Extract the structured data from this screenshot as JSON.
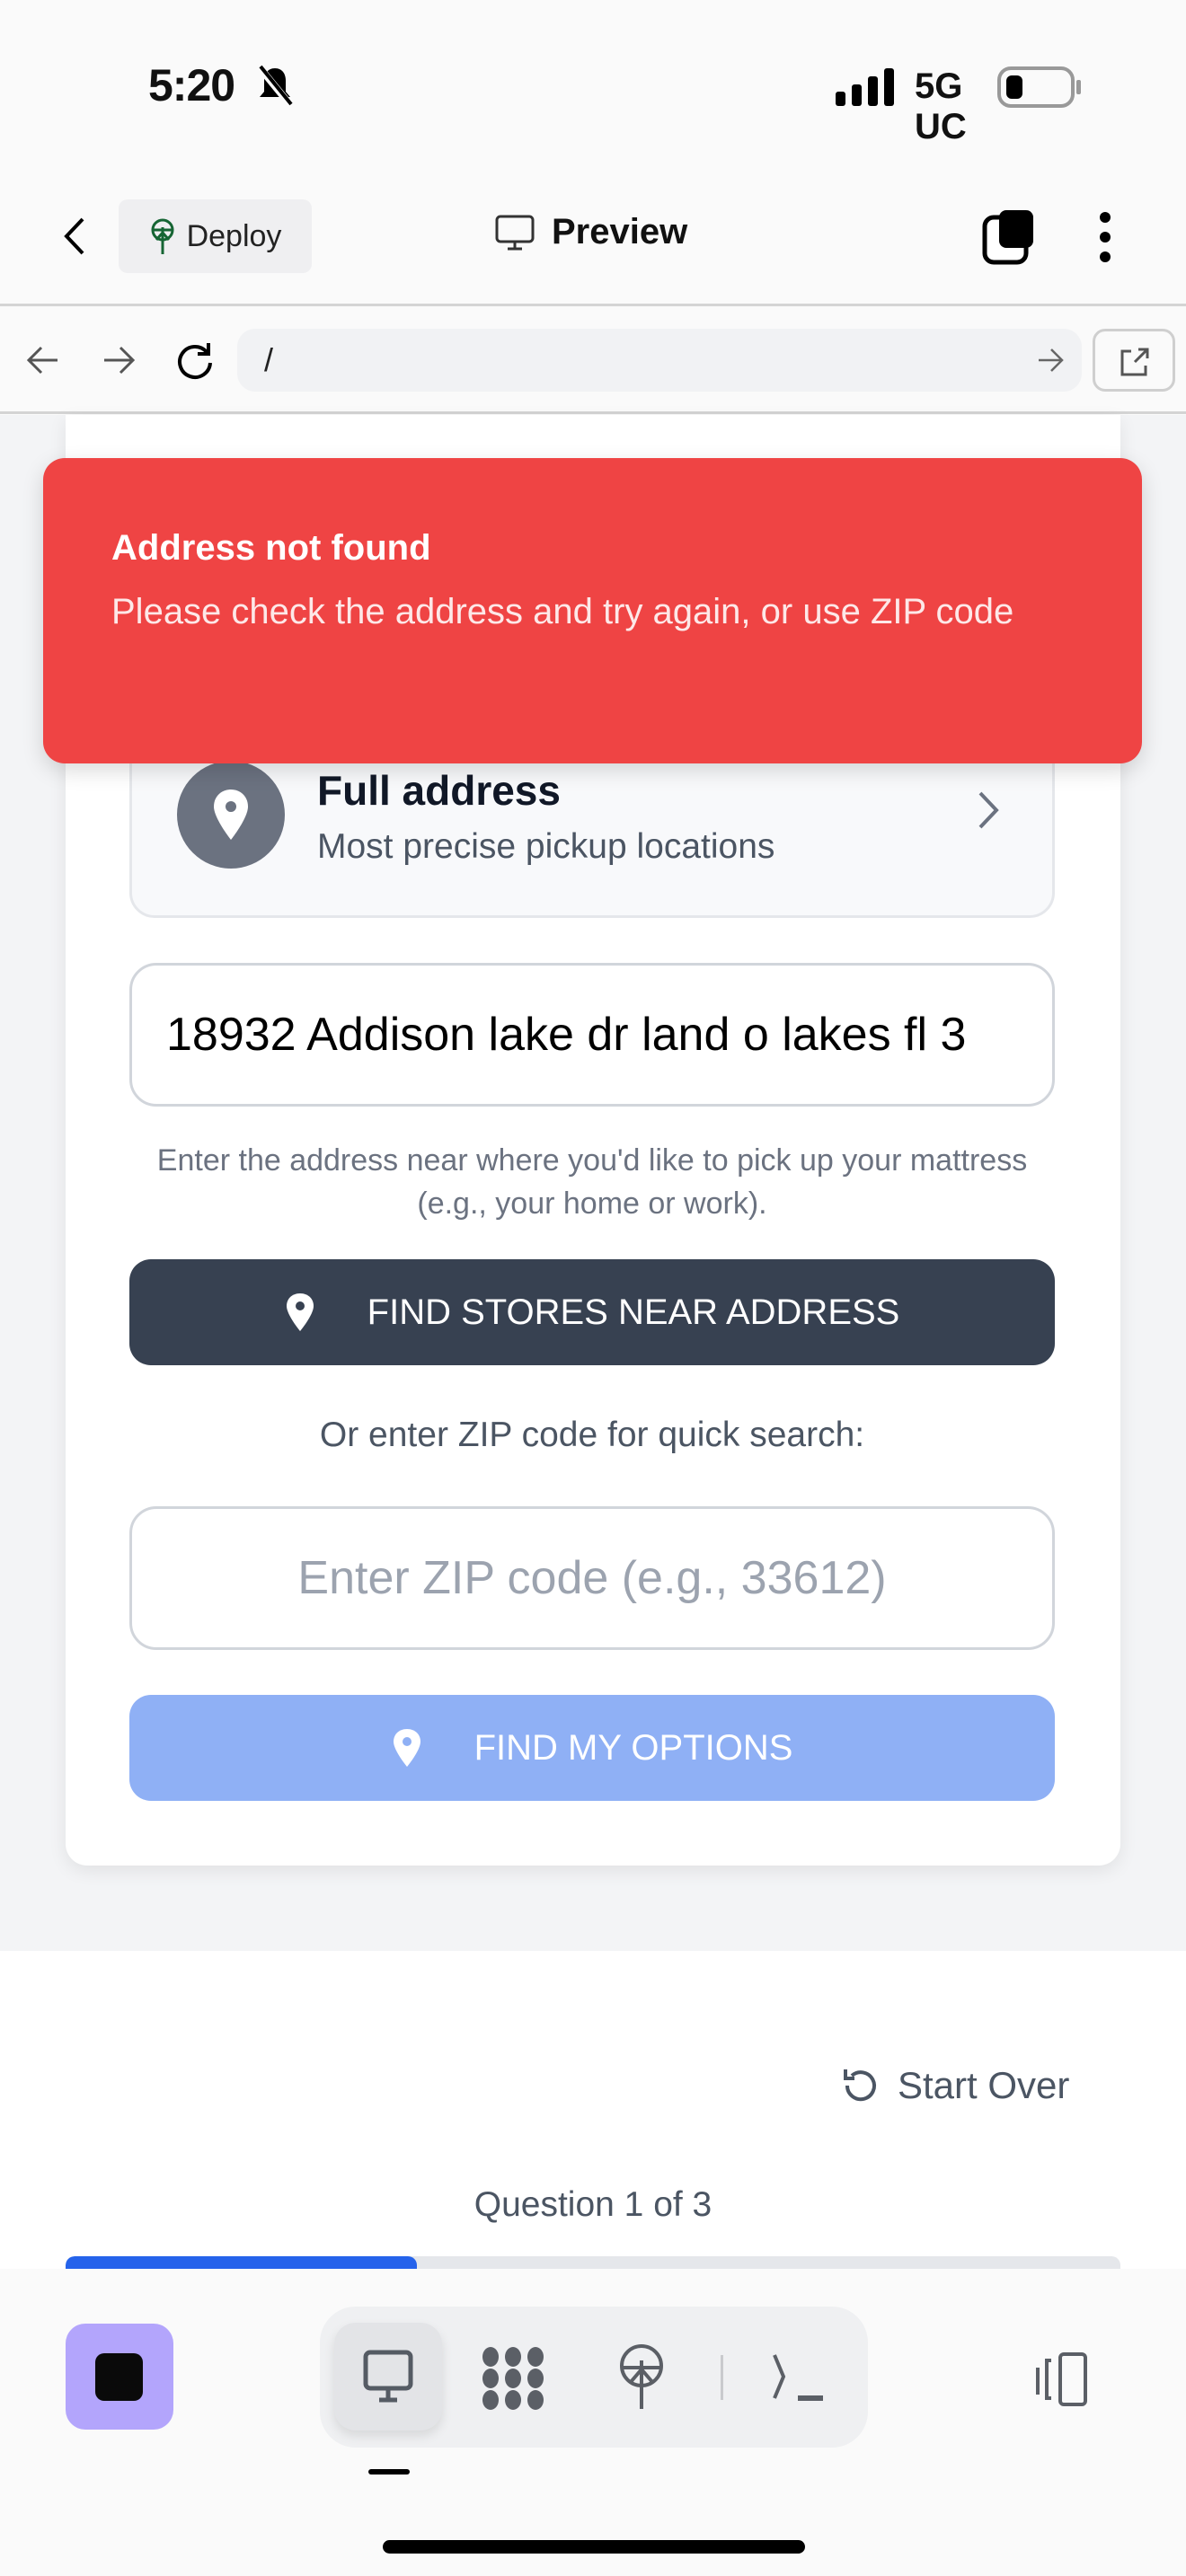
{
  "status_bar": {
    "time": "5:20",
    "network": "5G UC",
    "battery_percent": 20
  },
  "app_bar": {
    "deploy_label": "Deploy",
    "title": "Preview"
  },
  "browser": {
    "url": "/"
  },
  "toast": {
    "title": "Address not found",
    "message": "Please check the address and try again, or use ZIP code",
    "color": "#ef4444"
  },
  "form": {
    "option": {
      "title": "Full address",
      "subtitle": "Most precise pickup locations"
    },
    "address_value": "18932 Addison lake dr land o lakes fl 3",
    "helper": "Enter the address near where you'd like to pick up your mattress (e.g., your home or work).",
    "find_stores_label": "FIND STORES NEAR ADDRESS",
    "or_label": "Or enter ZIP code for quick search:",
    "zip_placeholder": "Enter ZIP code (e.g., 33612)",
    "find_options_label": "FIND MY OPTIONS"
  },
  "footer": {
    "start_over": "Start Over",
    "question": "Question 1 of 3",
    "progress": 0.333
  },
  "colors": {
    "accent": "#2563eb",
    "dark_button": "#374151",
    "disabled_button": "#8fb0f5"
  }
}
